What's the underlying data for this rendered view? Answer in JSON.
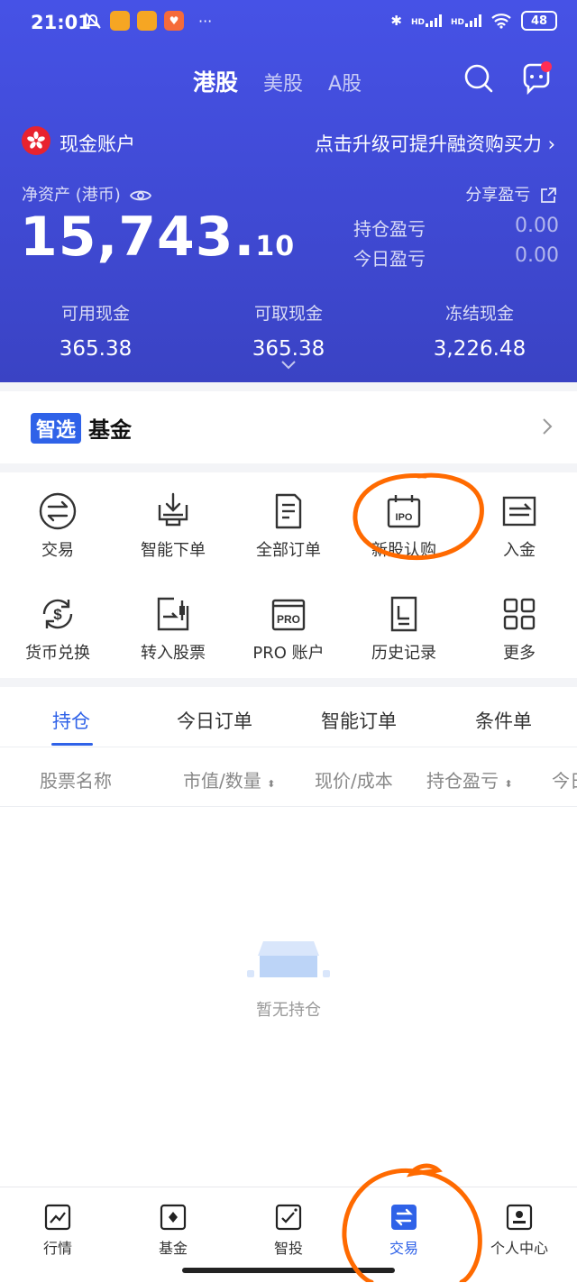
{
  "status_bar": {
    "time": "21:01",
    "battery": "48",
    "signal_1": "HD",
    "signal_2": "HD",
    "more": "···"
  },
  "market_tabs": [
    "港股",
    "美股",
    "A股"
  ],
  "account": {
    "name": "现金账户",
    "upgrade_text": "点击升级可提升融资购买力",
    "net_assets_label": "净资产 (港币)",
    "share_pl_label": "分享盈亏",
    "net_assets_int": "15,743.",
    "net_assets_dec": "10",
    "position_pl_label": "持仓盈亏",
    "position_pl_value": "0.00",
    "today_pl_label": "今日盈亏",
    "today_pl_value": "0.00",
    "cash": [
      {
        "label": "可用现金",
        "value": "365.38"
      },
      {
        "label": "可取现金",
        "value": "365.38"
      },
      {
        "label": "冻结现金",
        "value": "3,226.48"
      }
    ]
  },
  "fund_banner": {
    "badge": "智选",
    "text": "基金"
  },
  "quick_actions": [
    {
      "label": "交易",
      "icon": "exchange-icon"
    },
    {
      "label": "智能下单",
      "icon": "smart-order-icon"
    },
    {
      "label": "全部订单",
      "icon": "orders-icon"
    },
    {
      "label": "新股认购",
      "icon": "ipo-icon",
      "icon_text": "IPO"
    },
    {
      "label": "入金",
      "icon": "deposit-icon"
    },
    {
      "label": "货币兑换",
      "icon": "currency-exchange-icon"
    },
    {
      "label": "转入股票",
      "icon": "transfer-stock-icon"
    },
    {
      "label": "PRO 账户",
      "icon": "pro-icon",
      "icon_text": "PRO"
    },
    {
      "label": "历史记录",
      "icon": "history-icon"
    },
    {
      "label": "更多",
      "icon": "more-grid-icon"
    }
  ],
  "position_tabs": [
    "持仓",
    "今日订单",
    "智能订单",
    "条件单"
  ],
  "columns": [
    "股票名称",
    "市值/数量",
    "现价/成本",
    "持仓盈亏",
    "今日"
  ],
  "empty_text": "暂无持仓",
  "bottom_nav": [
    {
      "label": "行情",
      "icon": "market-chart-icon"
    },
    {
      "label": "基金",
      "icon": "fund-icon"
    },
    {
      "label": "智投",
      "icon": "smart-invest-icon"
    },
    {
      "label": "交易",
      "icon": "trade-icon",
      "active": true
    },
    {
      "label": "个人中心",
      "icon": "profile-icon"
    }
  ],
  "colors": {
    "header": "#4350e0",
    "accent": "#2f62e8",
    "annotation": "#ff6a00",
    "badge_dot": "#ff2d55"
  }
}
